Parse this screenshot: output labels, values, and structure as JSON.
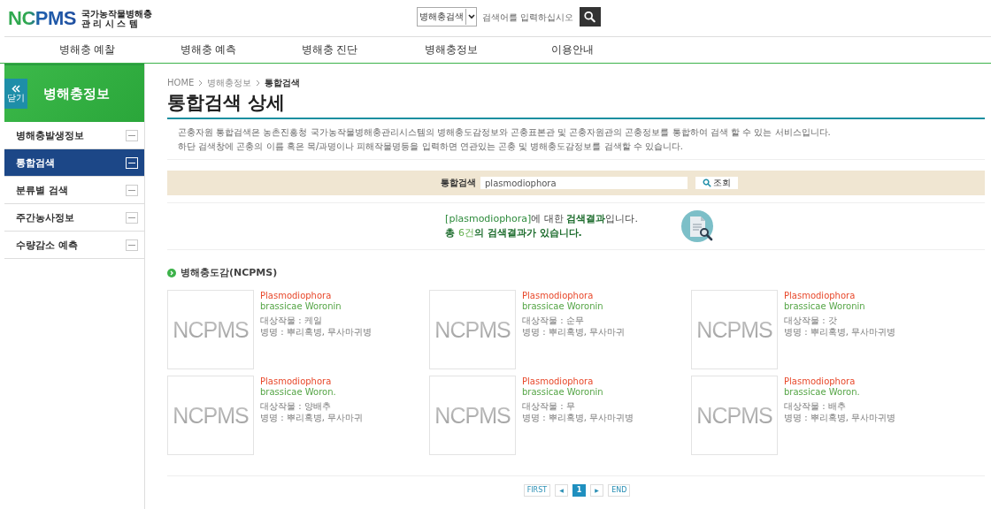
{
  "header": {
    "logo": "NCPMS",
    "logo_subtitle_1": "국가농작물병해충",
    "logo_subtitle_2": "관 리 시 스 템",
    "search_scope": "병해충검색",
    "search_placeholder": "검색어를 입력하십시오"
  },
  "nav": [
    {
      "label": "병해충 예찰",
      "selected": false
    },
    {
      "label": "병해충 예측",
      "selected": false
    },
    {
      "label": "병해충 진단",
      "selected": false
    },
    {
      "label": "병해충정보",
      "selected": false
    },
    {
      "label": "이용안내",
      "selected": false
    }
  ],
  "sidebar": {
    "close_label": "닫기",
    "title": "병해충정보",
    "items": [
      {
        "label": "병해충발생정보",
        "selected": false
      },
      {
        "label": "통합검색",
        "selected": true
      },
      {
        "label": "분류별 검색",
        "selected": false
      },
      {
        "label": "주간농사정보",
        "selected": false
      },
      {
        "label": "수량감소 예측",
        "selected": false
      }
    ]
  },
  "breadcrumb": [
    "HOME",
    "병해충정보",
    "통합검색"
  ],
  "page_title": "통합검색 상세",
  "description": [
    "곤충자원 통합검색은 농촌진흥청 국가농작물병해충관리시스템의 병해충도감정보와 곤충표본관 및 곤충자원관의 곤충정보를 통합하여 검색 할 수 있는 서비스입니다.",
    "하단 검색창에 곤충의 이름 혹은 목/과명이나 피해작물명등을 입력하면 연관있는 곤충 및 병해충도감정보를 검색할 수 있습니다."
  ],
  "search": {
    "label": "통합검색",
    "value": "plasmodiophora",
    "button": "조회"
  },
  "result_message": [
    [
      {
        "text": "[plasmodiophora]",
        "kind": "accent"
      },
      {
        "text": "에 대한 ",
        "kind": "plain"
      },
      {
        "text": "검색결과",
        "kind": "strong"
      },
      {
        "text": "입니다.",
        "kind": "plain"
      }
    ],
    [
      {
        "text": "총 ",
        "kind": "strong"
      },
      {
        "text": "6건",
        "kind": "light"
      },
      {
        "text": "의 검색결과가 있습니다.",
        "kind": "strong"
      }
    ]
  ],
  "section_title": "병해충도감(NCPMS)",
  "cards": [
    {
      "image_text": "NCPMS",
      "name": "Plasmodiophora",
      "author": "brassicae Woronin",
      "crop": "대상작물 : 케일",
      "disease": "병명 : 뿌리혹병, 무사마귀병"
    },
    {
      "image_text": "NCPMS",
      "name": "Plasmodiophora",
      "author": "brassicae Woronin",
      "crop": "대상작물 : 순무",
      "disease": "병명 : 뿌리혹병, 무사마귀"
    },
    {
      "image_text": "NCPMS",
      "name": "Plasmodiophora",
      "author": "brassicae Woronin",
      "crop": "대상작물 : 갓",
      "disease": "병명 : 뿌리혹병, 무사마귀병"
    },
    {
      "image_text": "NCPMS",
      "name": "Plasmodiophora",
      "author": "brassicae Woron.",
      "crop": "대상작물 : 양배추",
      "disease": "병명 : 뿌리혹병, 무사마귀"
    },
    {
      "image_text": "NCPMS",
      "name": "Plasmodiophora",
      "author": "brassicae Woronin",
      "crop": "대상작물 : 무",
      "disease": "병명 : 뿌리혹병, 무사마귀병"
    },
    {
      "image_text": "NCPMS",
      "name": "Plasmodiophora",
      "author": "brassicae Woron.",
      "crop": "대상작물 : 배추",
      "disease": "병명 : 뿌리혹병, 무사마귀병"
    }
  ],
  "pagination": [
    {
      "label": "FIRST",
      "kind": "text",
      "selected": false
    },
    {
      "label": "◀",
      "kind": "arrow",
      "selected": false
    },
    {
      "label": "1",
      "kind": "page",
      "selected": true
    },
    {
      "label": "▶",
      "kind": "arrow",
      "selected": false
    },
    {
      "label": "END",
      "kind": "text",
      "selected": false
    }
  ]
}
